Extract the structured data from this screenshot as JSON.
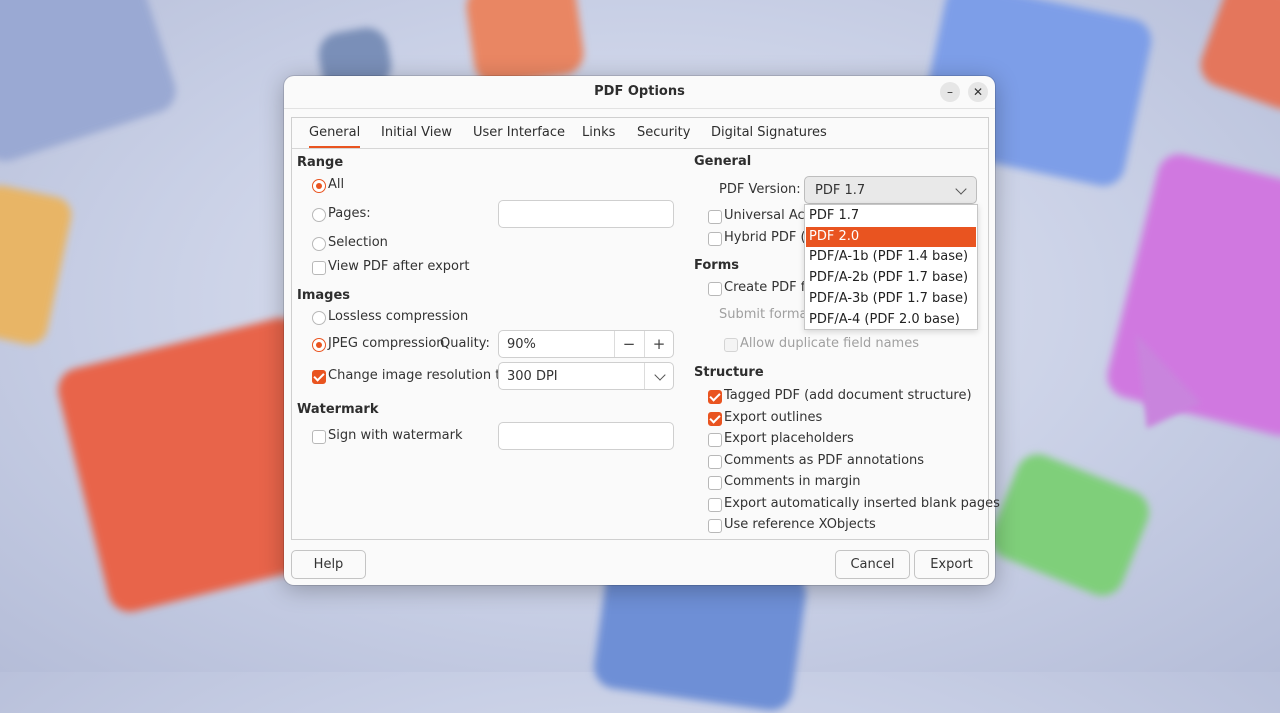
{
  "dialog": {
    "title": "PDF Options",
    "minimize_glyph": "–",
    "close_glyph": "✕"
  },
  "tabs": [
    "General",
    "Initial View",
    "User Interface",
    "Links",
    "Security",
    "Digital Signatures"
  ],
  "active_tab": "General",
  "range": {
    "heading": "Range",
    "all": "All",
    "pages": "Pages:",
    "pages_value": "",
    "selection": "Selection",
    "view_pdf": "View PDF after export",
    "selected": "All",
    "view_pdf_checked": false
  },
  "images": {
    "heading": "Images",
    "lossless": "Lossless compression",
    "jpeg": "JPEG compression",
    "quality_label": "Quality:",
    "quality_value": "90%",
    "minus": "−",
    "plus": "+",
    "change_res": "Change image resolution to:",
    "change_res_checked": true,
    "resolution_value": "300 DPI",
    "selected": "JPEG compression"
  },
  "watermark": {
    "heading": "Watermark",
    "sign": "Sign with watermark",
    "sign_checked": false,
    "text_value": ""
  },
  "general": {
    "heading": "General",
    "pdf_version_label": "PDF Version:",
    "pdf_version_value": "PDF 1.7",
    "universal_access": "Universal Acce",
    "hybrid_pdf": "Hybrid PDF (e",
    "version_options": [
      "PDF 1.7",
      "PDF 2.0",
      "PDF/A-1b (PDF 1.4 base)",
      "PDF/A-2b (PDF 1.7 base)",
      "PDF/A-3b (PDF 1.7 base)",
      "PDF/A-4 (PDF 2.0 base)"
    ],
    "highlighted_option": "PDF 2.0"
  },
  "forms": {
    "heading": "Forms",
    "create_pdf_form": "Create PDF fo",
    "submit_format": "Submit format",
    "allow_duplicate": "Allow duplicate field names"
  },
  "structure": {
    "heading": "Structure",
    "items": [
      {
        "label": "Tagged PDF (add document structure)",
        "checked": true
      },
      {
        "label": "Export outlines",
        "checked": true
      },
      {
        "label": "Export placeholders",
        "checked": false
      },
      {
        "label": "Comments as PDF annotations",
        "checked": false
      },
      {
        "label": "Comments in margin",
        "checked": false
      },
      {
        "label": "Export automatically inserted blank pages",
        "checked": false
      },
      {
        "label": "Use reference XObjects",
        "checked": false
      }
    ]
  },
  "buttons": {
    "help": "Help",
    "cancel": "Cancel",
    "export": "Export"
  },
  "colors": {
    "accent": "#e95420",
    "dialog_bg": "#fafafa"
  }
}
